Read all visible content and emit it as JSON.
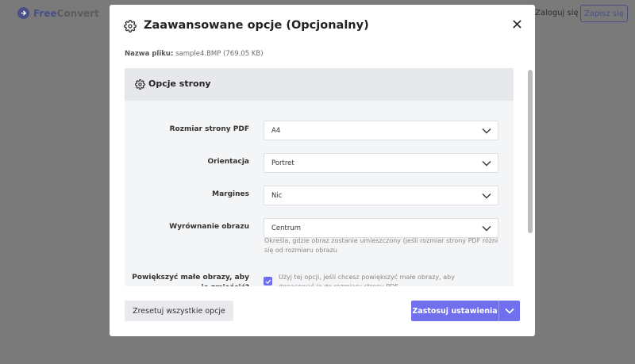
{
  "background": {
    "logo": {
      "part1": "Free",
      "part2": "Convert"
    },
    "login_label": "Zaloguj się",
    "signup_label": "Zapisz się"
  },
  "modal": {
    "title": "Zaawansowane opcje (Opcjonalny)",
    "filename_label": "Nazwa pliku:",
    "filename_value": "sample4.BMP (769.05 KB)",
    "section_title": "Opcje strony",
    "fields": [
      {
        "label": "Rozmiar strony PDF",
        "value": "A4"
      },
      {
        "label": "Orientacja",
        "value": "Portret"
      },
      {
        "label": "Margines",
        "value": "Nic"
      },
      {
        "label": "Wyrównanie obrazu",
        "value": "Centrum"
      }
    ],
    "alignment_hint": "Określa, gdzie obraz zostanie umieszczony (jeśli rozmiar strony PDF różni się od rozmiaru obrazu",
    "enlarge": {
      "label": "Powiększyć małe obrazy, aby je zmieścić?",
      "description": "Użyj tej opcji, jeśli chcesz powiększyć małe obrazy, aby dopasować je do rozmiaru strony PDF",
      "checked": true
    },
    "buttons": {
      "reset": "Zresetuj wszystkie opcje",
      "apply": "Zastosuj ustawienia"
    }
  },
  "colors": {
    "accent": "#7070ee",
    "logo": "#4a4f86"
  }
}
